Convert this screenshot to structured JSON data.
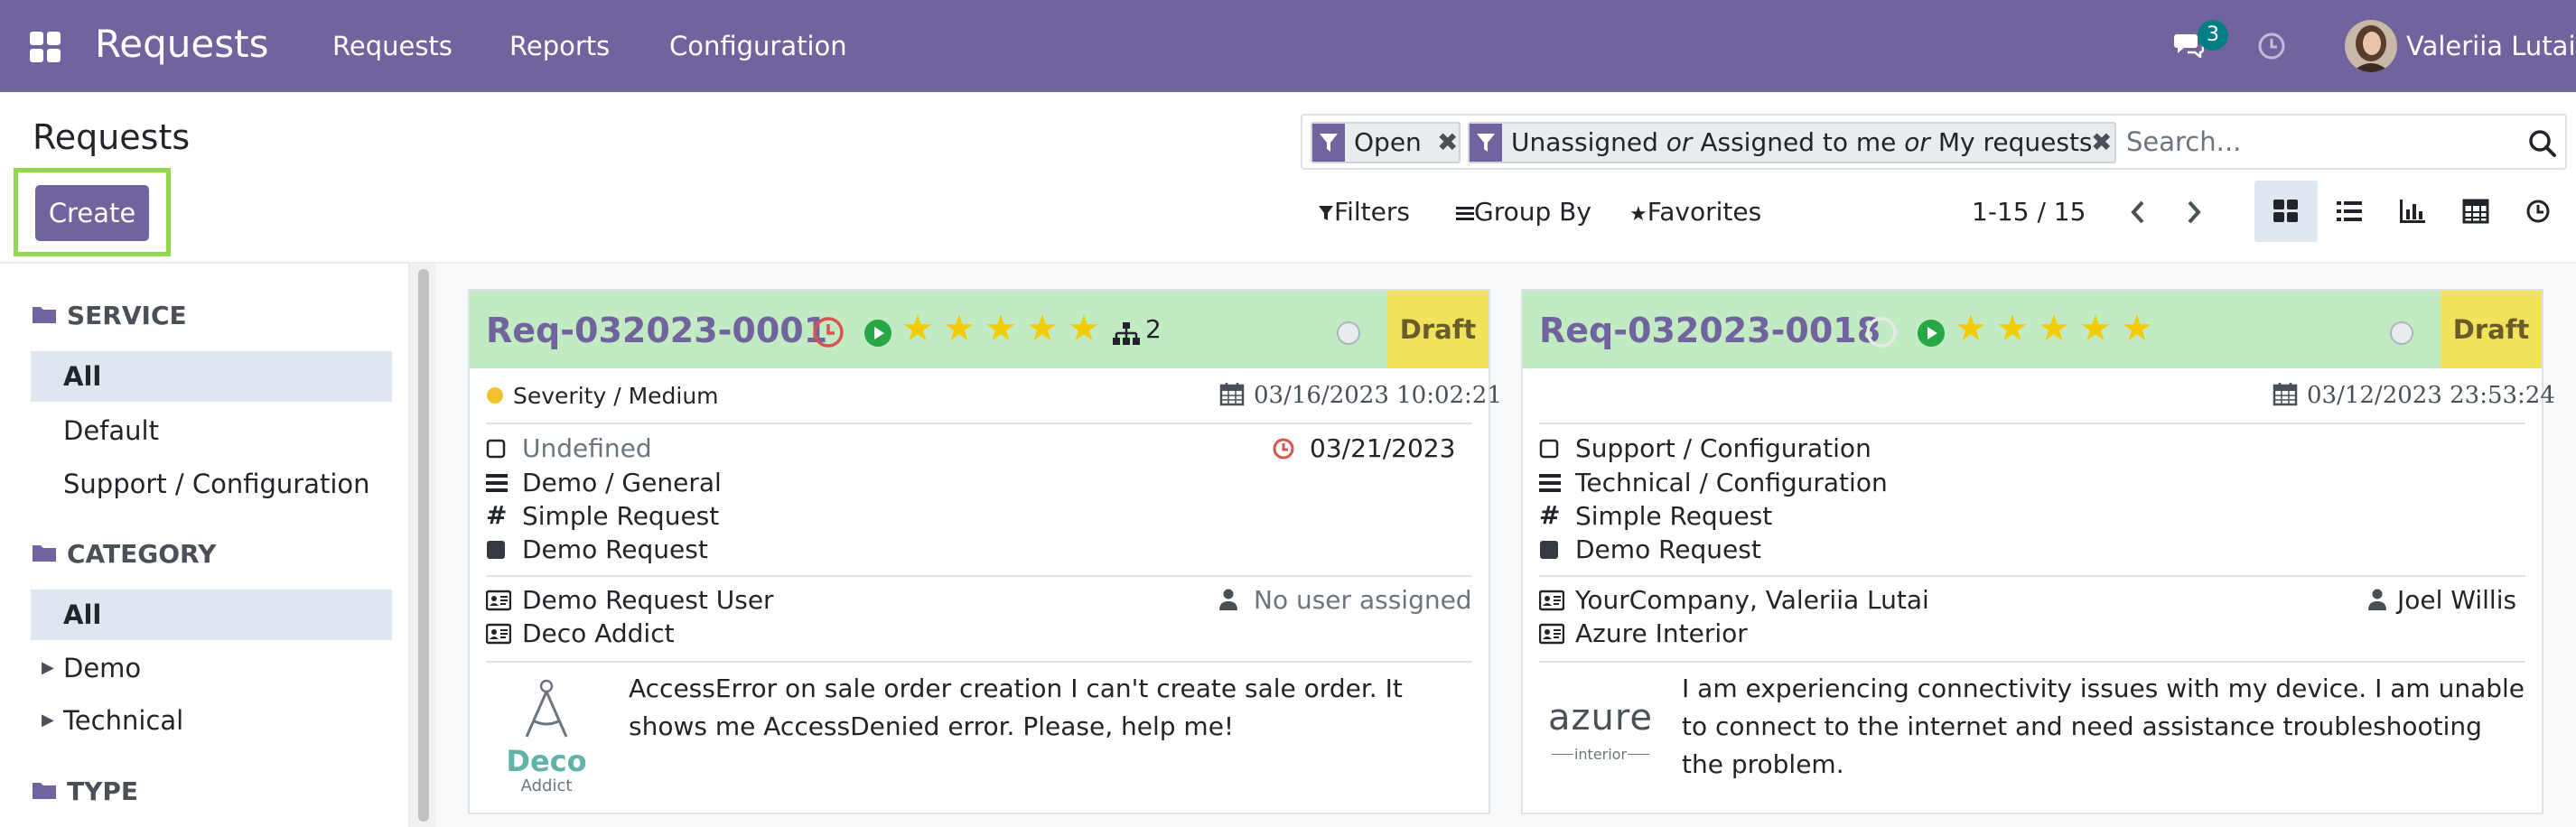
{
  "navbar": {
    "app_title": "Requests",
    "menus": [
      "Requests",
      "Reports",
      "Configuration"
    ],
    "chat_count": "3",
    "user_name": "Valeriia Lutai"
  },
  "control_panel": {
    "title": "Requests",
    "create_label": "Create",
    "facets": {
      "open": "Open",
      "assign_a": "Unassigned",
      "or1": "or",
      "assign_b": "Assigned to me",
      "or2": "or",
      "assign_c": "My requests"
    },
    "search_placeholder": "Search...",
    "filters_label": "Filters",
    "groupby_label": "Group By",
    "favorites_label": "Favorites",
    "pager": "1-15 / 15"
  },
  "side_panel": {
    "service": {
      "header": "SERVICE",
      "items": [
        "All",
        "Default",
        "Support / Configuration"
      ]
    },
    "category": {
      "header": "CATEGORY",
      "items": [
        "All",
        "Demo",
        "Technical"
      ]
    },
    "type": {
      "header": "TYPE"
    }
  },
  "cards": [
    {
      "ref": "Req-032023-0001",
      "stage": "Draft",
      "rating": 5,
      "subrequests": "2",
      "severity": "Severity / Medium",
      "created": "03/16/2023 10:02:21",
      "service": "Undefined",
      "deadline": "03/21/2023",
      "category": "Demo / General",
      "type": "Simple Request",
      "kind": "Demo Request",
      "author": "Demo Request User",
      "assignee": "No user assigned",
      "partner": "Deco Addict",
      "logo_main": "Deco",
      "logo_sub": "Addict",
      "description": "AccessError on sale order creation I can't create sale order. It shows me AccessDenied error. Please, help me!"
    },
    {
      "ref": "Req-032023-0018",
      "stage": "Draft",
      "rating": 5,
      "created": "03/12/2023 23:53:24",
      "service": "Support / Configuration",
      "category": "Technical / Configuration",
      "type": "Simple Request",
      "kind": "Demo Request",
      "author": "YourCompany, Valeriia Lutai",
      "assignee": "Joel Willis",
      "partner": "Azure Interior",
      "logo_main": "azure",
      "logo_sub": "interior",
      "description": "I am experiencing connectivity issues with my device. I am unable to connect to the internet and need assistance troubleshooting the problem."
    }
  ],
  "colors": {
    "brand": "#71639e",
    "card_header": "#c3ebc3",
    "stage_draft": "#f3e35c",
    "star": "#f3cc00",
    "deco_logo": "#5fb3a8"
  }
}
